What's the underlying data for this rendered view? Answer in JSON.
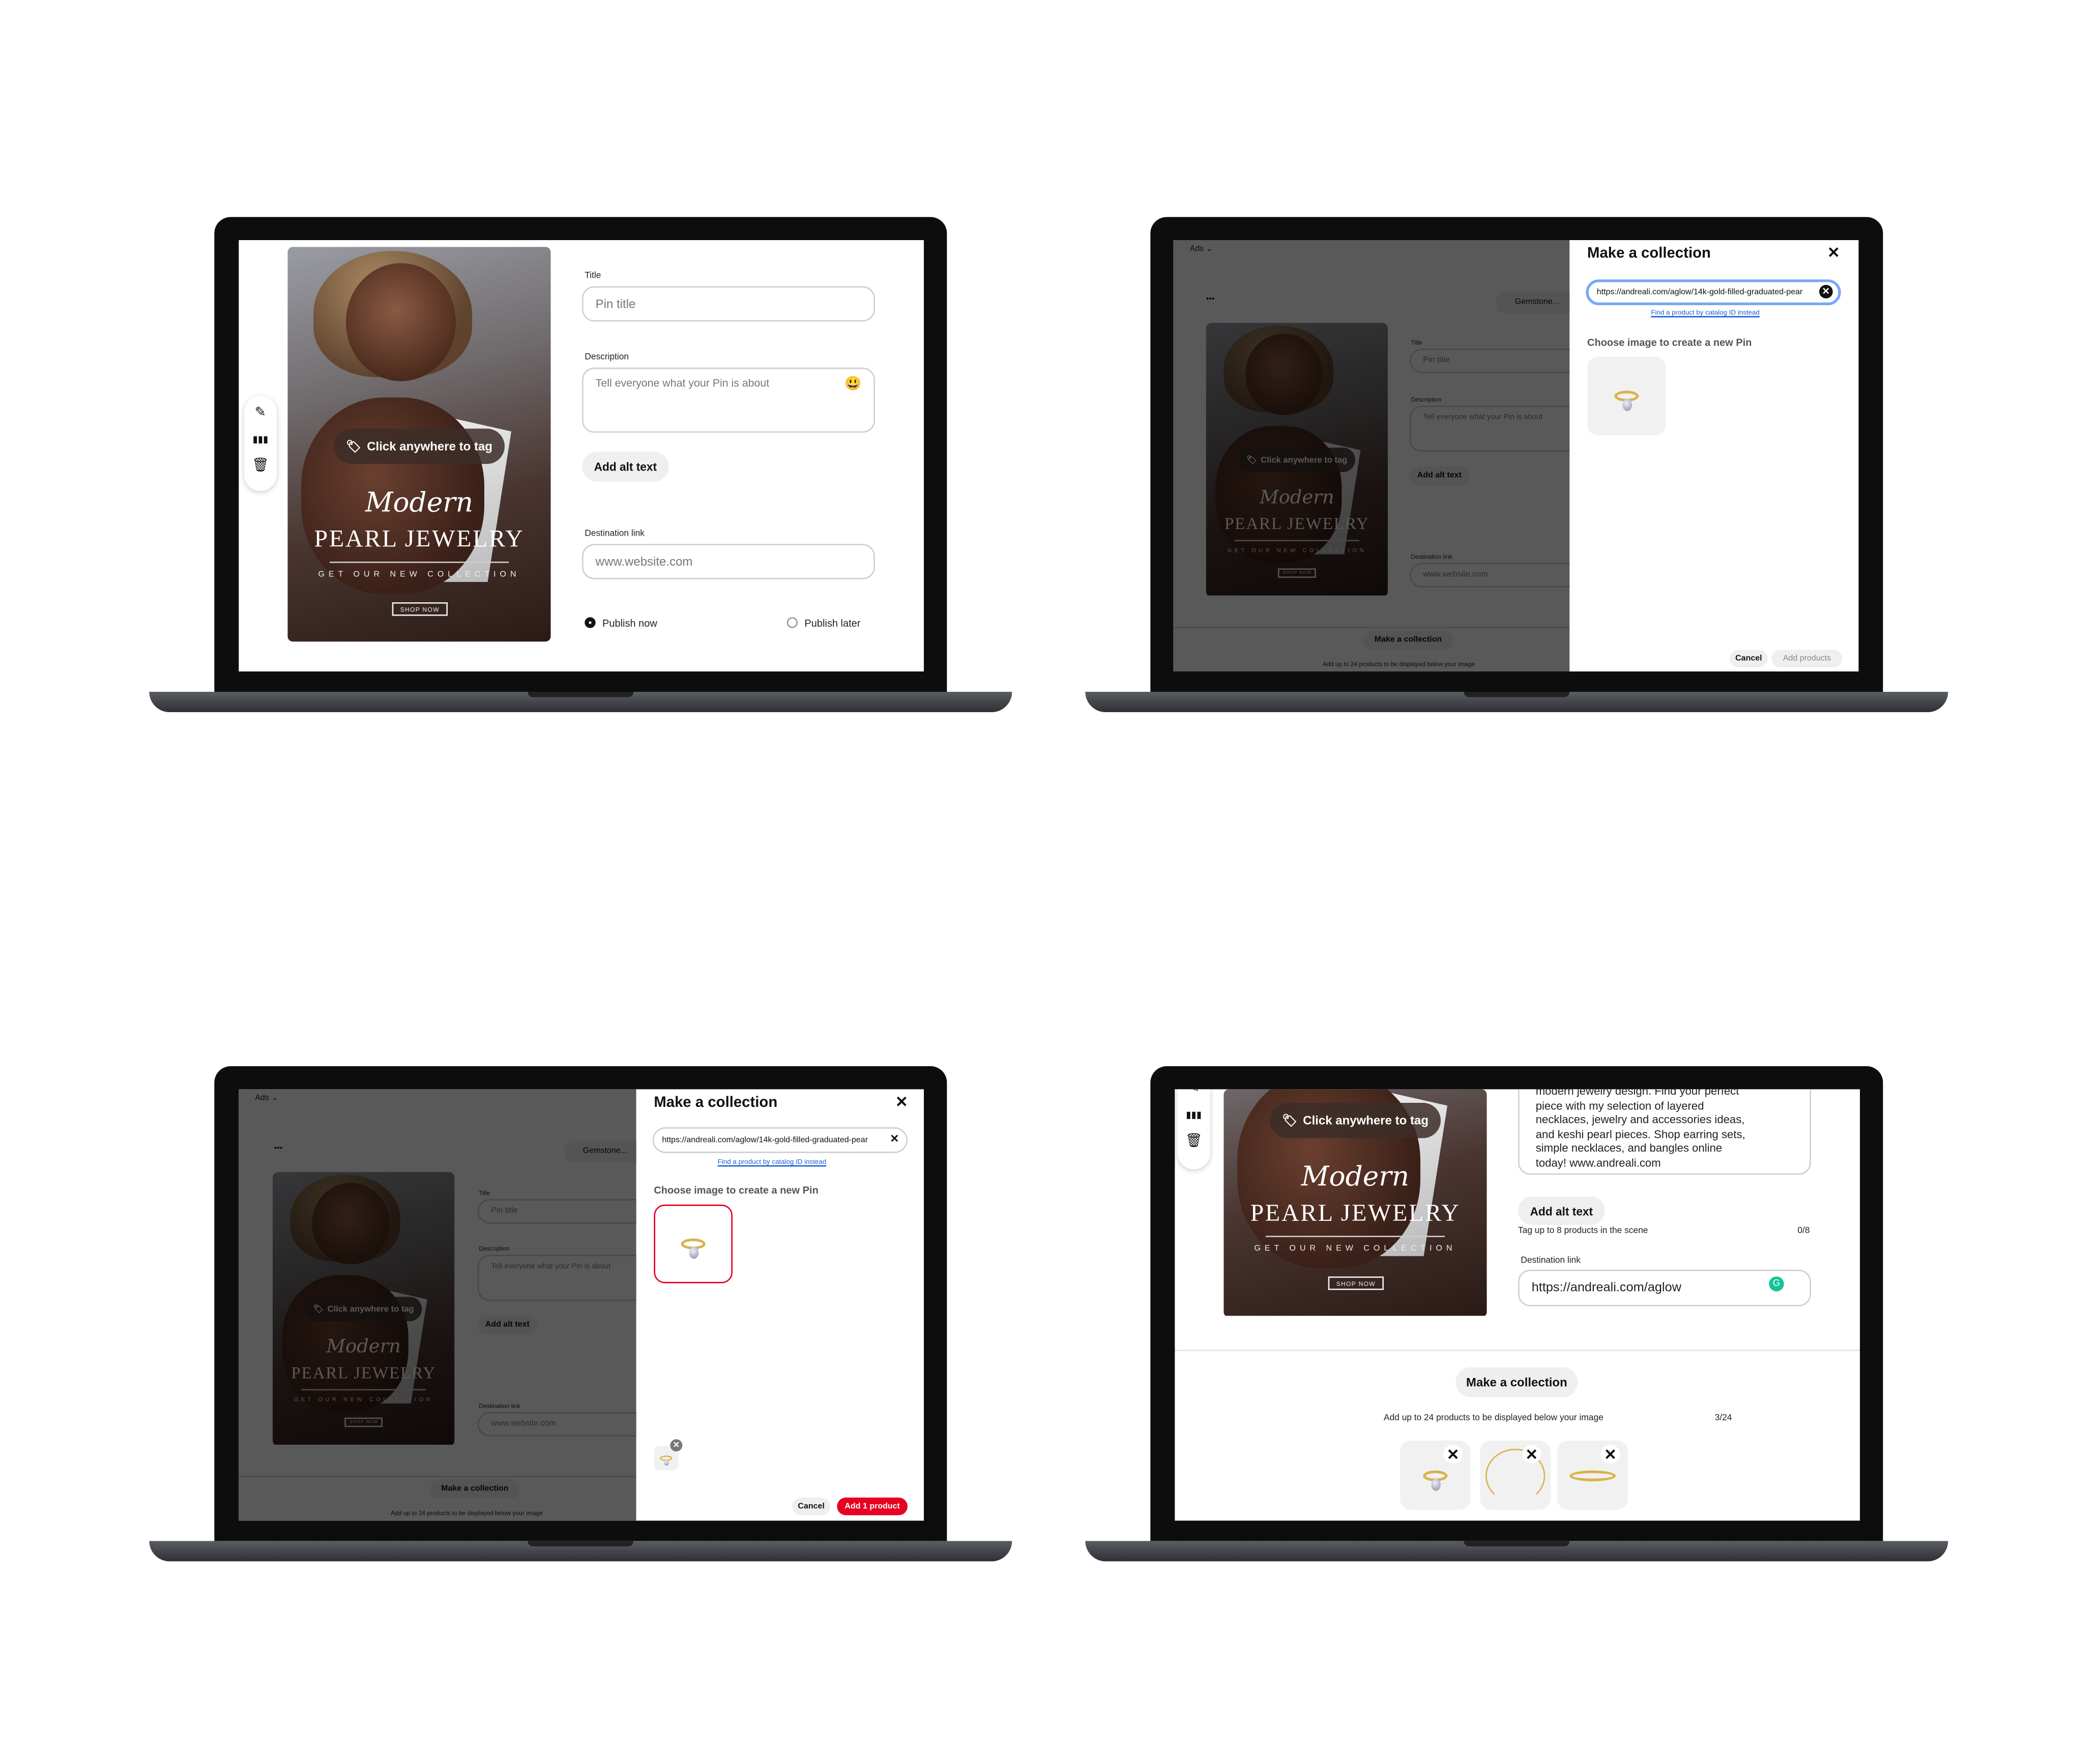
{
  "pin_creative": {
    "tag_hint": "Click anywhere to tag",
    "script_word": "Modern",
    "headline": "PEARL JEWELRY",
    "subline": "GET OUR NEW COLLECTION",
    "cta": "SHOP NOW"
  },
  "form": {
    "title_label": "Title",
    "title_placeholder": "Pin title",
    "description_label": "Description",
    "description_placeholder": "Tell everyone what your Pin is about",
    "alt_text_button": "Add alt text",
    "destination_label": "Destination link",
    "destination_placeholder": "www.website.com",
    "publish_now": "Publish now",
    "publish_later": "Publish later",
    "publish_selected": "Publish now"
  },
  "background": {
    "ads_menu": "Ads",
    "more": "•••",
    "board_select": "Gemstone...",
    "make_collection": "Make a collection",
    "collection_note": "Add up to 24 products to be displayed below your image"
  },
  "modal": {
    "title": "Make a collection",
    "url_value": "https://andreali.com/aglow/14k-gold-filled-graduated-pear",
    "catalog_link": "Find a product by catalog ID instead",
    "choose_label": "Choose image to create a new Pin",
    "cancel": "Cancel",
    "add_products": "Add products",
    "add_one_product": "Add 1 product"
  },
  "screen4": {
    "description_lines": [
      "modern jewelry design. Find your perfect",
      "piece with my selection of layered",
      "necklaces, jewelry and accessories ideas,",
      "and keshi pearl pieces. Shop earring sets,",
      "simple necklaces, and bangles online",
      "today! www.andreali.com"
    ],
    "tag_products": "Tag up to 8 products in the scene",
    "tag_count": "0/8",
    "destination_value": "https://andreali.com/aglow",
    "collection_count": "3/24"
  },
  "colors": {
    "primary_red": "#e60023",
    "focus_blue": "#7aa7f7",
    "link_blue": "#1a5fd6",
    "grammarly_green": "#15c39a"
  },
  "icons": [
    "pencil-icon",
    "columns-icon",
    "trash-icon",
    "tag-icon",
    "close-icon",
    "emoji-icon",
    "grammarly-icon",
    "chevron-down-icon"
  ]
}
